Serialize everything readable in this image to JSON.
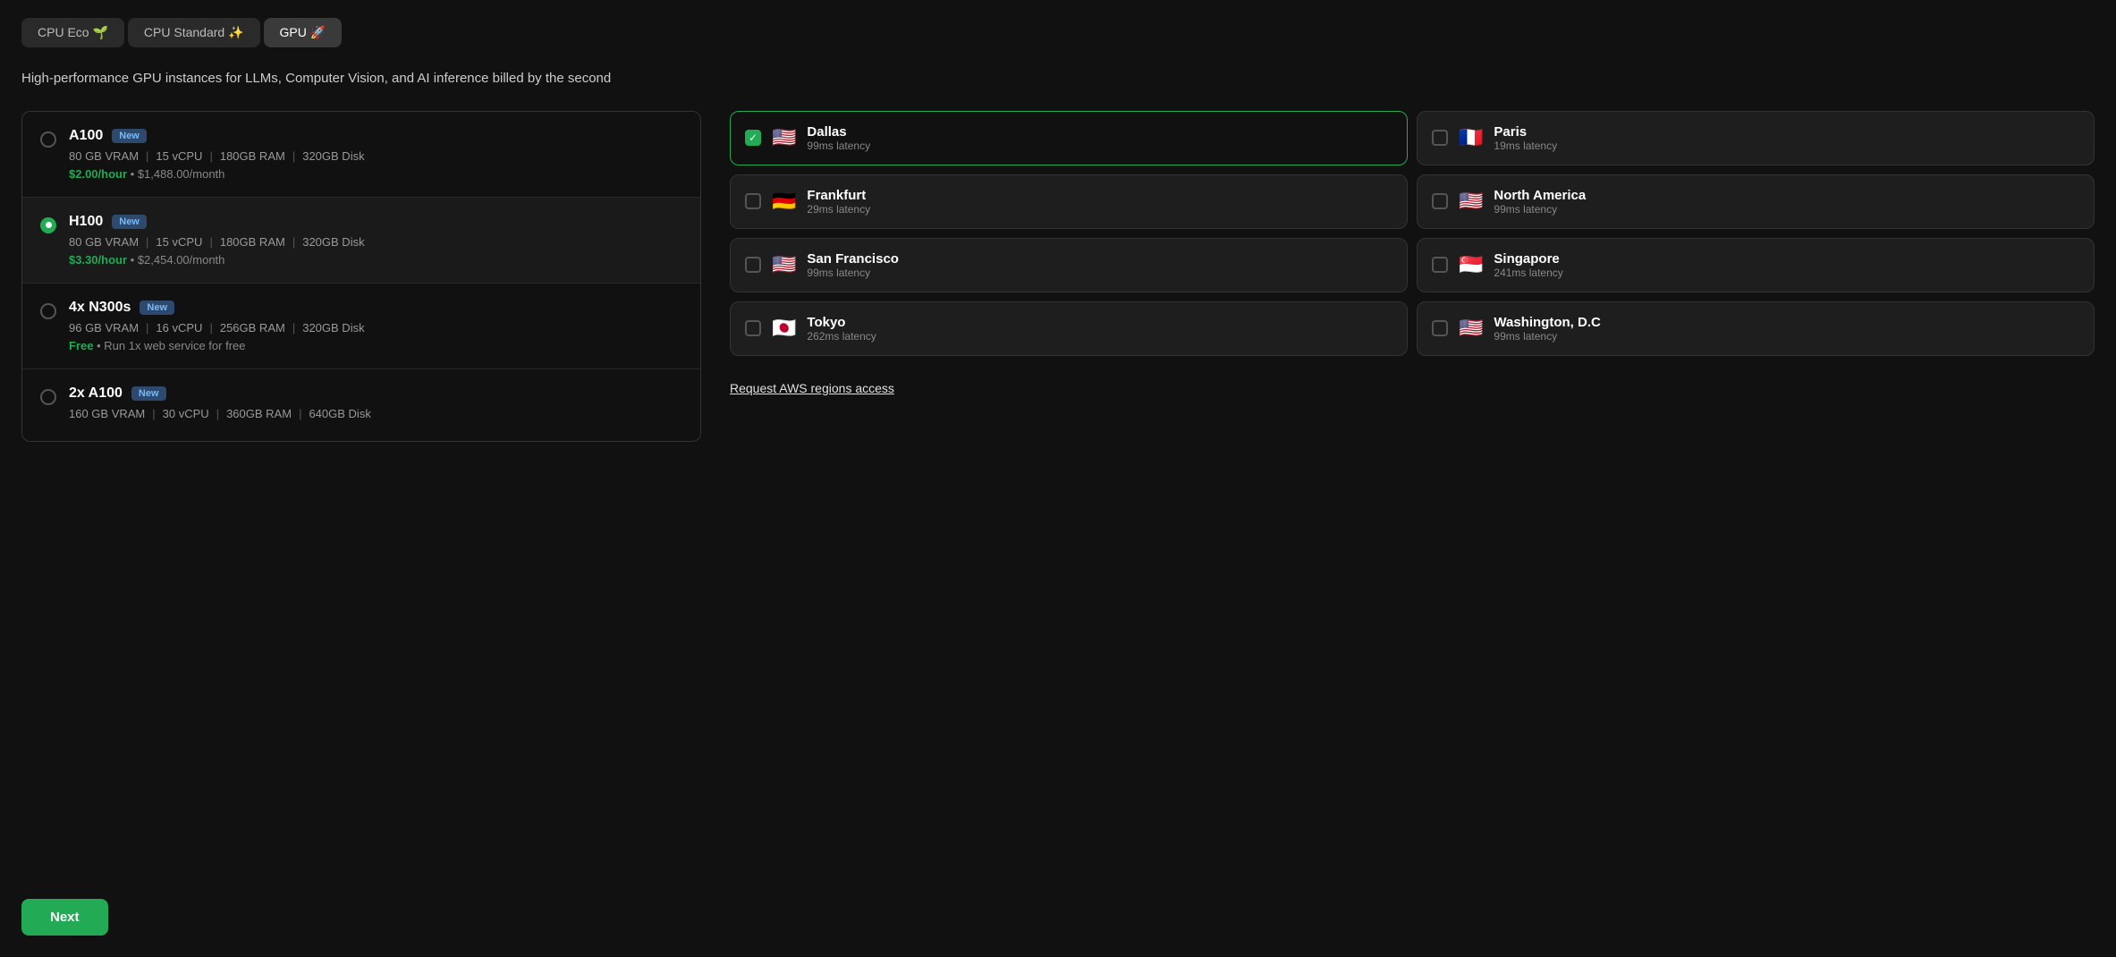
{
  "tabs": [
    {
      "id": "cpu-eco",
      "label": "CPU Eco 🌱",
      "active": false
    },
    {
      "id": "cpu-standard",
      "label": "CPU Standard ✨",
      "active": false
    },
    {
      "id": "gpu",
      "label": "GPU 🚀",
      "active": true
    }
  ],
  "description": "High-performance GPU instances for LLMs, Computer Vision, and AI inference billed by the second",
  "instances": [
    {
      "id": "a100",
      "name": "A100",
      "badge": "New",
      "vram": "80 GB VRAM",
      "vcpu": "15 vCPU",
      "ram": "180GB RAM",
      "disk": "320GB Disk",
      "price_hourly": "$2.00/hour",
      "price_monthly": "$1,488.00/month",
      "selected": false
    },
    {
      "id": "h100",
      "name": "H100",
      "badge": "New",
      "vram": "80 GB VRAM",
      "vcpu": "15 vCPU",
      "ram": "180GB RAM",
      "disk": "320GB Disk",
      "price_hourly": "$3.30/hour",
      "price_monthly": "$2,454.00/month",
      "selected": true
    },
    {
      "id": "4x-n300s",
      "name": "4x N300s",
      "badge": "New",
      "vram": "96 GB VRAM",
      "vcpu": "16 vCPU",
      "ram": "256GB RAM",
      "disk": "320GB Disk",
      "price_hourly": "Free",
      "price_monthly": "Run 1x web service for free",
      "is_free": true,
      "selected": false
    },
    {
      "id": "2x-a100",
      "name": "2x A100",
      "badge": "New",
      "vram": "160 GB VRAM",
      "vcpu": "30 vCPU",
      "ram": "360GB RAM",
      "disk": "640GB Disk",
      "price_hourly": "",
      "price_monthly": "",
      "selected": false
    }
  ],
  "regions": [
    {
      "id": "dallas",
      "name": "Dallas",
      "latency": "99ms latency",
      "flag": "🇺🇸",
      "selected": true
    },
    {
      "id": "paris",
      "name": "Paris",
      "latency": "19ms latency",
      "flag": "🇫🇷",
      "selected": false
    },
    {
      "id": "frankfurt",
      "name": "Frankfurt",
      "latency": "29ms latency",
      "flag": "🇩🇪",
      "selected": false
    },
    {
      "id": "north-america",
      "name": "North America",
      "latency": "99ms latency",
      "flag": "🇺🇸",
      "selected": false
    },
    {
      "id": "san-francisco",
      "name": "San Francisco",
      "latency": "99ms latency",
      "flag": "🇺🇸",
      "selected": false
    },
    {
      "id": "singapore",
      "name": "Singapore",
      "latency": "241ms latency",
      "flag": "🇸🇬",
      "selected": false
    },
    {
      "id": "tokyo",
      "name": "Tokyo",
      "latency": "262ms latency",
      "flag": "🇯🇵",
      "selected": false
    },
    {
      "id": "washington-dc",
      "name": "Washington, D.C",
      "latency": "99ms latency",
      "flag": "🇺🇸",
      "selected": false
    }
  ],
  "aws_link_label": "Request AWS regions access",
  "next_button_label": "Next"
}
